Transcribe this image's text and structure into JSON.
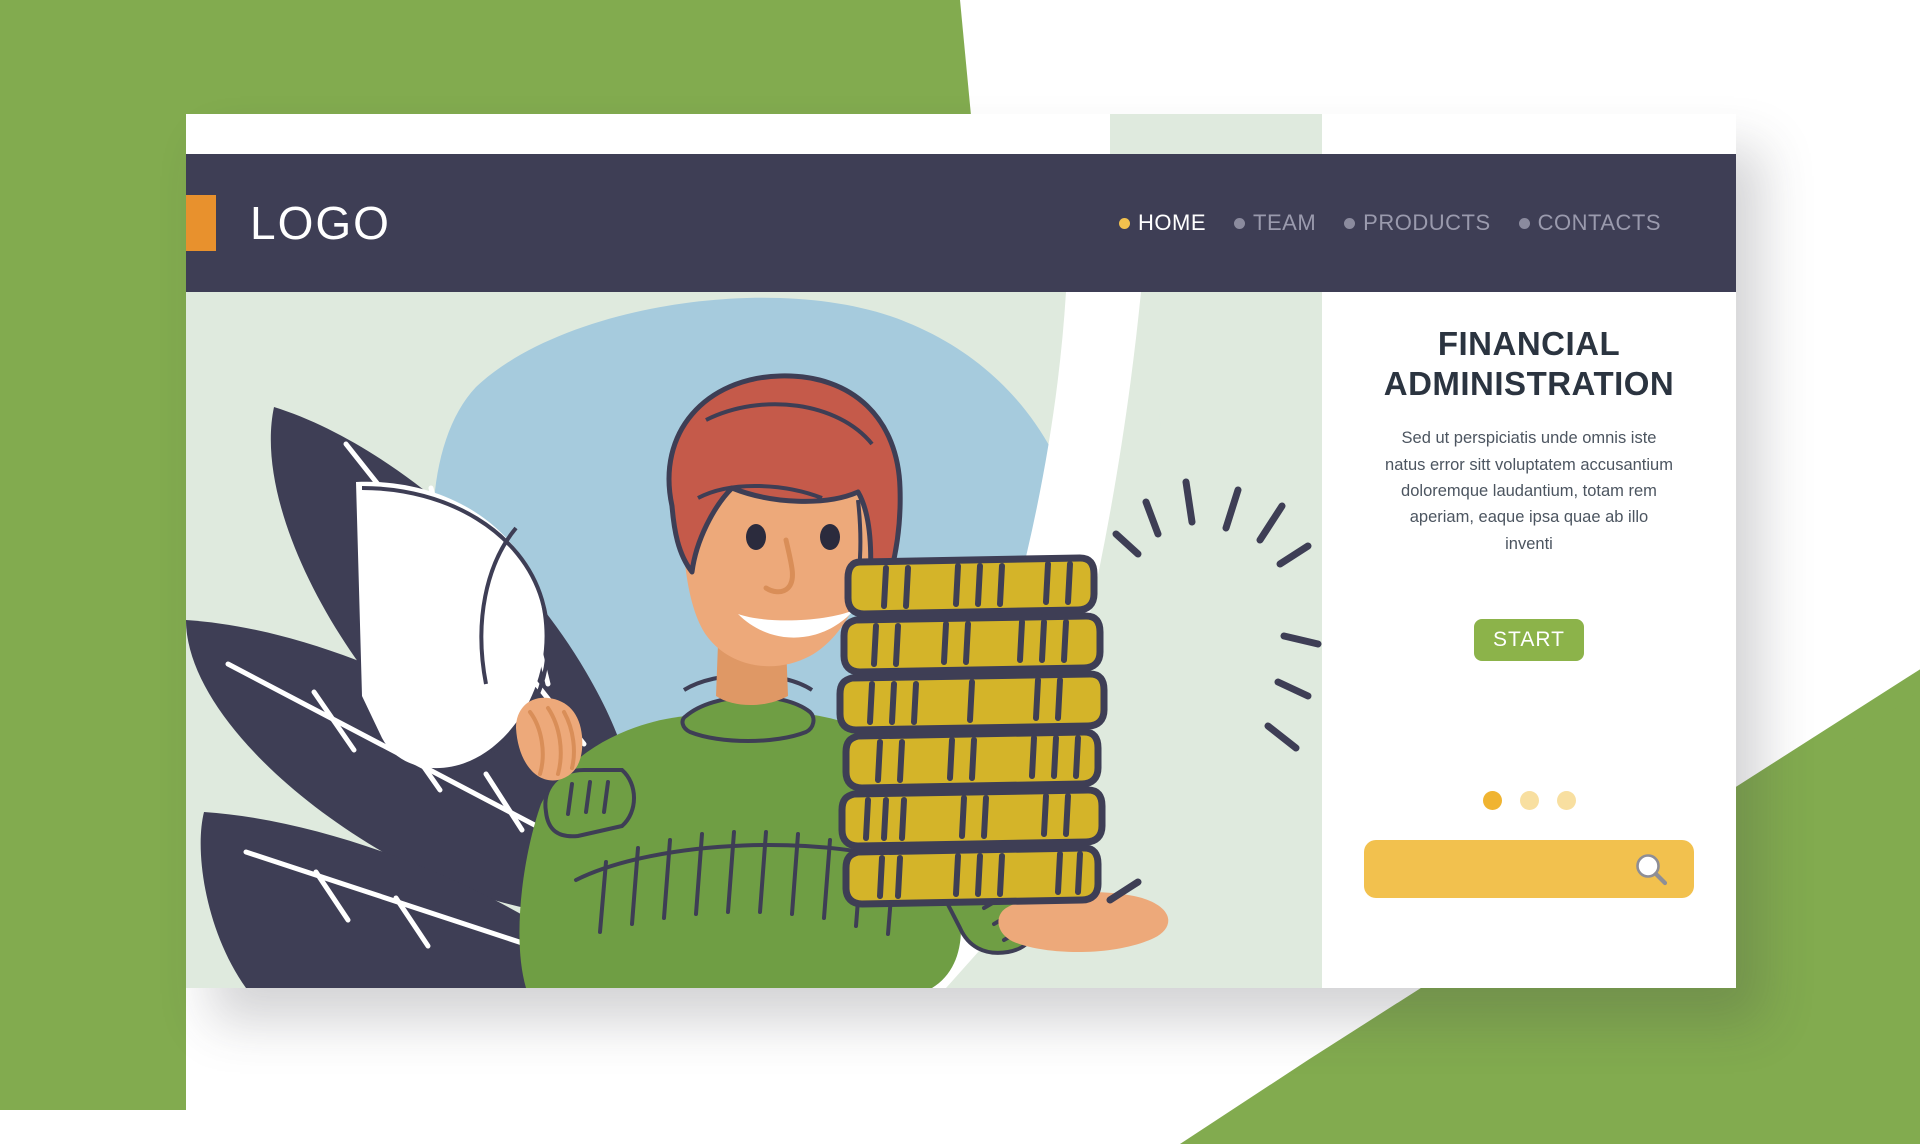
{
  "brand": {
    "logo_text": "LOGO",
    "accent_square_color": "#e8912d"
  },
  "nav": {
    "items": [
      {
        "label": "HOME",
        "active": true
      },
      {
        "label": "TEAM",
        "active": false
      },
      {
        "label": "PRODUCTS",
        "active": false
      },
      {
        "label": "CONTACTS",
        "active": false
      }
    ]
  },
  "hero": {
    "headline_line1": "FINANCIAL",
    "headline_line2": "ADMINISTRATION",
    "body": "Sed ut perspiciatis unde omnis iste natus error sitt voluptatem accusantium doloremque laudantium, totam rem aperiam, eaque ipsa quae ab illo inventi",
    "cta_label": "START"
  },
  "carousel": {
    "total": 3,
    "active_index": 0
  },
  "search": {
    "value": "",
    "placeholder": "",
    "icon": "magnifier-icon"
  },
  "colors": {
    "navbar": "#3e3e55",
    "page_green": "#82ab4f",
    "mint": "#dfeade",
    "accent_amber": "#f2c14e",
    "cta_green": "#8cb34a",
    "ink": "#3e3e55",
    "coin_gold": "#d4b429",
    "sweater_green": "#6f9e44",
    "hair_red": "#c55a4a",
    "skin": "#eda97a",
    "sky_blue": "#a6cbdd"
  },
  "illustration": {
    "name": "man-holding-stack-of-gold-coins",
    "elements": [
      "leaves",
      "paper-sheet",
      "character",
      "coin-stack",
      "sparkles"
    ]
  }
}
